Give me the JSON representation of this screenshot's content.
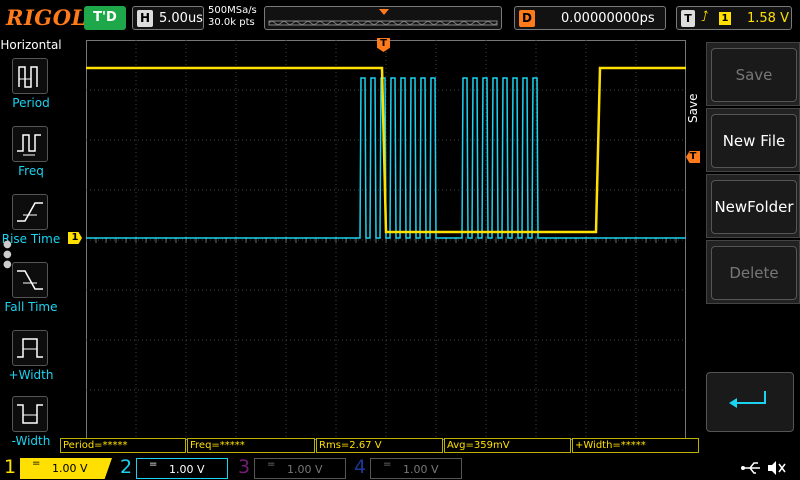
{
  "brand": "RIGOL",
  "status": {
    "trigger_state": "T'D"
  },
  "timebase": {
    "key": "H",
    "value": "5.00us"
  },
  "sampling": {
    "rate": "500MSa/s",
    "points": "30.0k pts"
  },
  "delay": {
    "key": "D",
    "value": "0.00000000ps"
  },
  "trigger": {
    "key": "T",
    "source": "1",
    "level": "1.58 V"
  },
  "left_menu": {
    "title": "Horizontal",
    "items": [
      {
        "label": "Period",
        "icon": "period-icon"
      },
      {
        "label": "Freq",
        "icon": "frequency-icon"
      },
      {
        "label": "Rise Time",
        "icon": "rise-time-icon"
      },
      {
        "label": "Fall Time",
        "icon": "fall-time-icon"
      },
      {
        "label": "+Width",
        "icon": "positive-width-icon"
      },
      {
        "label": "-Width",
        "icon": "negative-width-icon"
      }
    ]
  },
  "right_menu": {
    "title": "Save",
    "buttons": [
      {
        "label": "Save",
        "enabled": false
      },
      {
        "label": "New File",
        "enabled": true
      },
      {
        "label": "NewFolder",
        "enabled": true
      },
      {
        "label": "Delete",
        "enabled": false
      }
    ],
    "back_icon": "return-arrow-icon"
  },
  "markers": {
    "trigger_pos": "T",
    "ch1_offset": "1",
    "trigger_level": "T"
  },
  "measurements": [
    "Period=*****",
    "Freq=*****",
    "Rms=2.67 V",
    "Avg=359mV",
    "+Width=*****"
  ],
  "channels": [
    {
      "num": "1",
      "coupling": "=",
      "scale": "1.00 V"
    },
    {
      "num": "2",
      "coupling": "=",
      "scale": "1.00 V"
    },
    {
      "num": "3",
      "coupling": "=",
      "scale": "1.00 V"
    },
    {
      "num": "4",
      "coupling": "=",
      "scale": "1.00 V"
    }
  ],
  "status_icons": [
    "usb-icon",
    "mute-icon"
  ],
  "colors": {
    "ch1": "#ffe000",
    "ch2": "#1bd3f0",
    "ch3": "#c030c0",
    "ch4": "#3060ff",
    "trigger": "#ff7a1a",
    "run": "#1fa84a"
  }
}
